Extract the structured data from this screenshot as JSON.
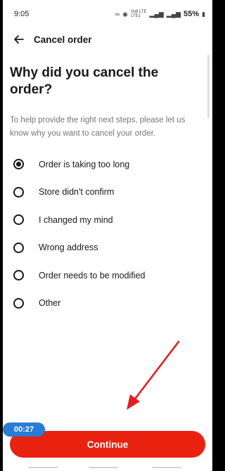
{
  "status_bar": {
    "time": "9:05",
    "net_label": "Vo8 LTE\nLTE1",
    "battery": "55%"
  },
  "app_bar": {
    "title": "Cancel order"
  },
  "heading": "Why did you cancel the order?",
  "description": "To help provide the right next steps, please let us know why you want to cancel your order.",
  "options": [
    {
      "label": "Order is taking too long",
      "selected": true
    },
    {
      "label": "Store didn't confirm",
      "selected": false
    },
    {
      "label": "I changed my mind",
      "selected": false
    },
    {
      "label": "Wrong address",
      "selected": false
    },
    {
      "label": "Order needs to be modified",
      "selected": false
    },
    {
      "label": "Other",
      "selected": false
    }
  ],
  "timer": "00:27",
  "continue_label": "Continue",
  "colors": {
    "accent": "#e8220f",
    "timer_badge": "#2a7bd6",
    "annotation_arrow": "#e32020"
  }
}
